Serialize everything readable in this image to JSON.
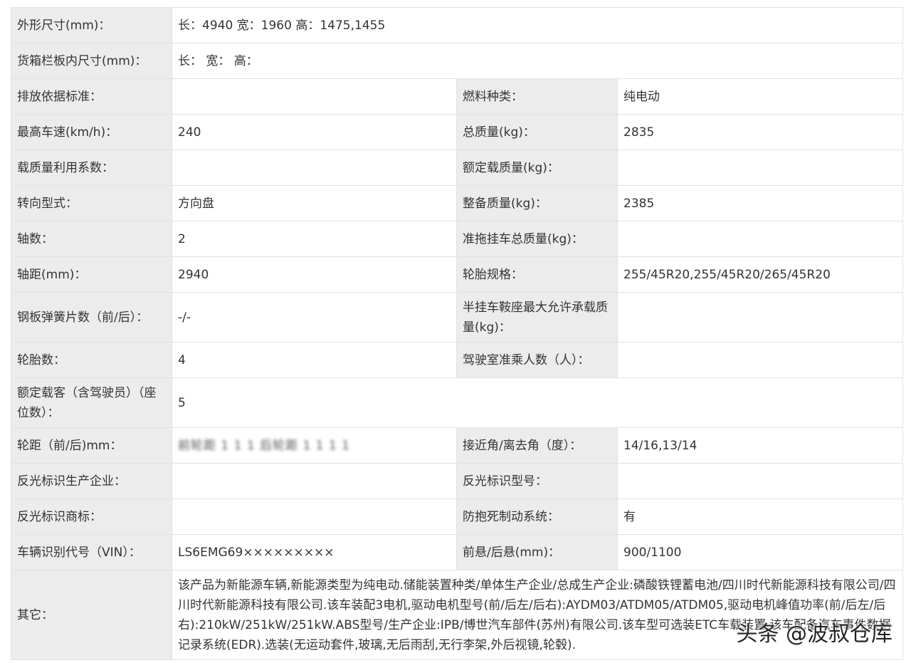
{
  "rows": [
    {
      "label": "外形尺寸(mm)：",
      "value": "长：4940 宽：1960 高：1475,1455"
    },
    {
      "label": "货箱栏板内尺寸(mm)：",
      "value": "长： 宽： 高："
    },
    {
      "label": "排放依据标准：",
      "value": "",
      "label2": "燃料种类：",
      "value2": "纯电动"
    },
    {
      "label": "最高车速(km/h)：",
      "value": "240",
      "label2": "总质量(kg)：",
      "value2": "2835"
    },
    {
      "label": "载质量利用系数：",
      "value": "",
      "label2": "额定载质量(kg)：",
      "value2": ""
    },
    {
      "label": "转向型式：",
      "value": "方向盘",
      "label2": "整备质量(kg)：",
      "value2": "2385"
    },
    {
      "label": "轴数：",
      "value": "2",
      "label2": "准拖挂车总质量(kg)：",
      "value2": ""
    },
    {
      "label": "轴距(mm)：",
      "value": "2940",
      "label2": "轮胎规格：",
      "value2": "255/45R20,255/45R20/265/45R20"
    },
    {
      "label": "钢板弹簧片数（前/后）：",
      "value": "-/-",
      "label2": "半挂车鞍座最大允许承载质量(kg)：",
      "value2": ""
    },
    {
      "label": "轮胎数：",
      "value": "4",
      "label2": "驾驶室准乘人数（人）：",
      "value2": ""
    },
    {
      "label": "额定载客（含驾驶员）（座位数）：",
      "value": "5"
    },
    {
      "label": "轮距（前/后)mm：",
      "value": "前轮距 1 1 1 后轮距 1 1 1 1",
      "label2": "接近角/离去角（度）：",
      "value2": "14/16,13/14"
    },
    {
      "label": "反光标识生产企业：",
      "value": "",
      "label2": "反光标识型号：",
      "value2": ""
    },
    {
      "label": "反光标识商标：",
      "value": "",
      "label2": "防抱死制动系统：",
      "value2": "有"
    },
    {
      "label": "车辆识别代号（VIN）：",
      "value": "LS6EMG69×××××××××",
      "label2": "前悬/后悬(mm)：",
      "value2": "900/1100"
    },
    {
      "label": "其它：",
      "value": "该产品为新能源车辆,新能源类型为纯电动.储能装置种类/单体生产企业/总成生产企业:磷酸铁锂蓄电池/四川时代新能源科技有限公司/四川时代新能源科技有限公司.该车装配3电机,驱动电机型号(前/后左/后右):AYDM03/ATDM05/ATDM05,驱动电机峰值功率(前/后左/后右):210kW/251kW/251kW.ABS型号/生产企业:IPB/博世汽车部件(苏州)有限公司.该车型可选装ETC车载装置.该车配备汽车事件数据记录系统(EDR).选装(无运动套件,玻璃,无后雨刮,无行李架,外后视镜,轮毂)."
    }
  ],
  "watermark": "头条 @波叔仓库"
}
